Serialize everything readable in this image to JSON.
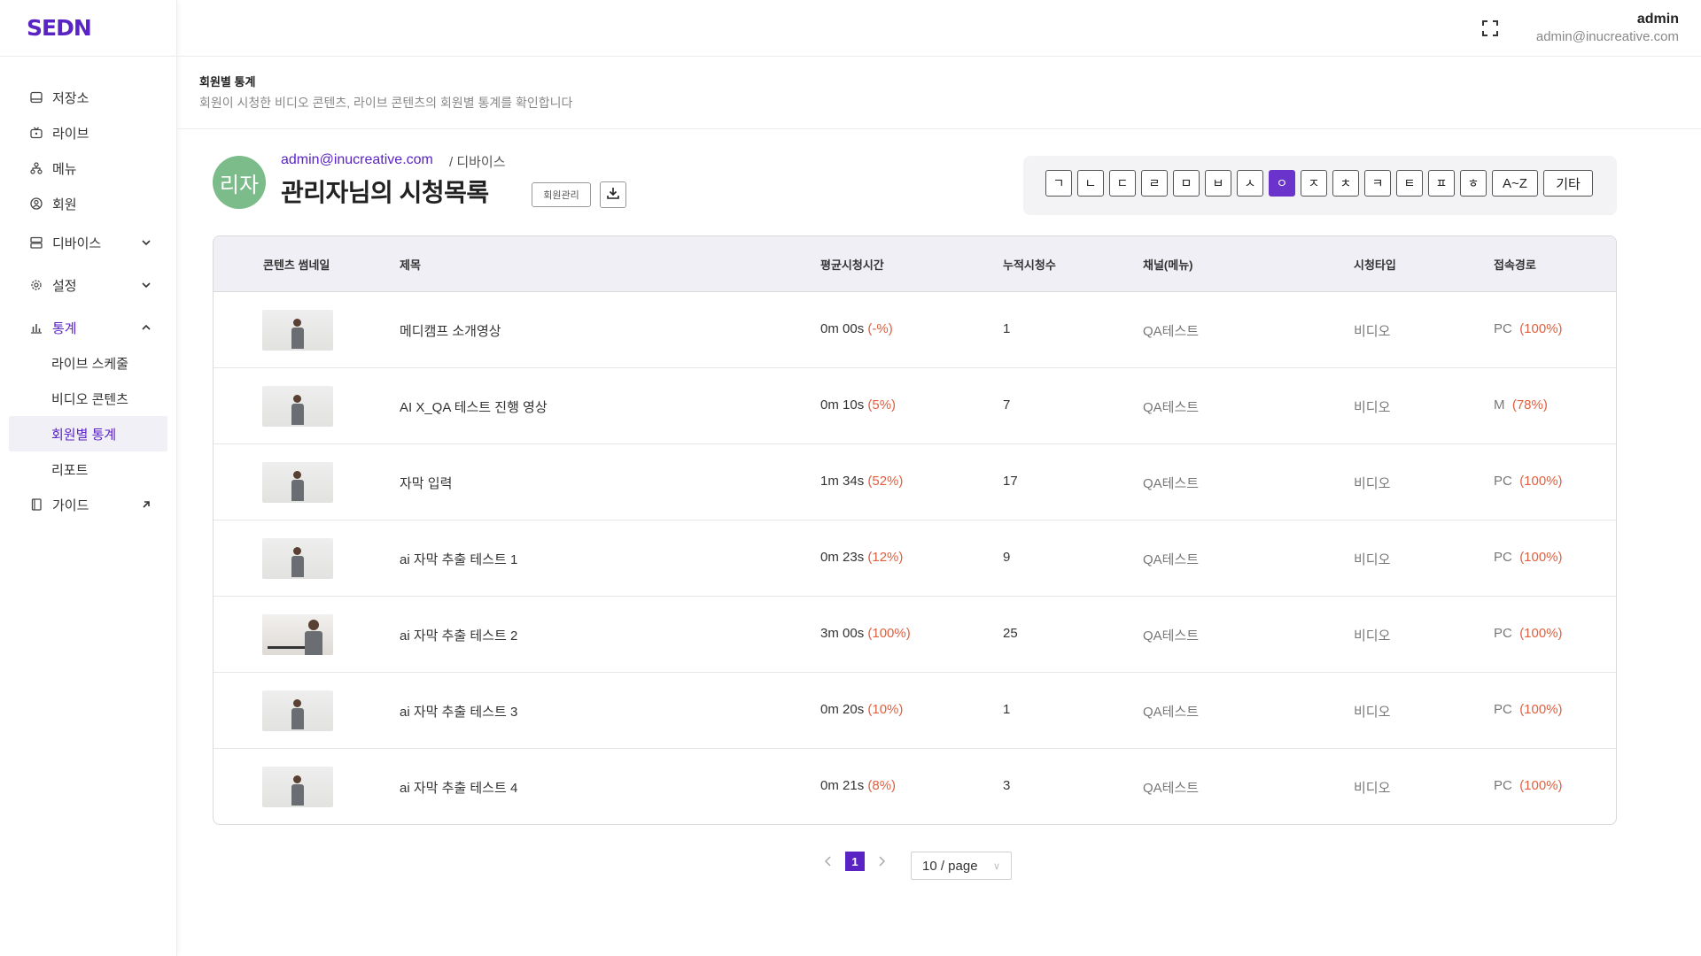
{
  "brand": {
    "logo": "SEDN",
    "accent": "#5a24c4"
  },
  "sidebar": {
    "items": [
      {
        "label": "저장소",
        "icon": "storage-icon"
      },
      {
        "label": "라이브",
        "icon": "live-tv-icon"
      },
      {
        "label": "메뉴",
        "icon": "menu-tree-icon"
      },
      {
        "label": "회원",
        "icon": "user-circle-icon"
      },
      {
        "label": "디바이스",
        "icon": "device-icon",
        "expandable": true,
        "expanded": false
      },
      {
        "label": "설정",
        "icon": "gear-icon",
        "expandable": true,
        "expanded": false
      },
      {
        "label": "통계",
        "icon": "bar-chart-icon",
        "expandable": true,
        "expanded": true
      }
    ],
    "stats_sub": [
      "라이브 스케줄",
      "비디오 콘텐츠",
      "회원별 통계",
      "리포트"
    ],
    "active_sub": "회원별 통계",
    "guide": {
      "label": "가이드",
      "icon": "book-icon"
    }
  },
  "topbar": {
    "user_name": "admin",
    "user_email": "admin@inucreative.com"
  },
  "page": {
    "title": "회원별 통계",
    "description": "회원이 시청한 비디오 콘텐츠, 라이브 콘텐츠의 회원별 통계를 확인합니다"
  },
  "profile": {
    "avatar_text": "리자",
    "avatar_color": "#7cbc8a",
    "email": "admin@inucreative.com",
    "breadcrumb": "/ 디바이스",
    "heading": "관리자님의 시청목록",
    "manage_button": "회원관리"
  },
  "filter": {
    "buttons": [
      "ㄱ",
      "ㄴ",
      "ㄷ",
      "ㄹ",
      "ㅁ",
      "ㅂ",
      "ㅅ",
      "ㅇ",
      "ㅈ",
      "ㅊ",
      "ㅋ",
      "ㅌ",
      "ㅍ",
      "ㅎ",
      "A~Z",
      "기타"
    ],
    "active": "ㅇ"
  },
  "table": {
    "headers": [
      "콘텐츠 썸네일",
      "제목",
      "평균시청시간",
      "누적시청수",
      "채널(메뉴)",
      "시청타입",
      "접속경로"
    ],
    "rows": [
      {
        "title": "메디캠프 소개영상",
        "avg_time": "0m 00s",
        "avg_pct": "(-%)",
        "views": "1",
        "channel": "QA테스트",
        "type": "비디오",
        "path": "PC",
        "path_pct": "(100%)"
      },
      {
        "title": "AI X_QA 테스트 진행 영상",
        "avg_time": "0m 10s",
        "avg_pct": "(5%)",
        "views": "7",
        "channel": "QA테스트",
        "type": "비디오",
        "path": "M",
        "path_pct": "(78%)"
      },
      {
        "title": "자막 입력",
        "avg_time": "1m 34s",
        "avg_pct": "(52%)",
        "views": "17",
        "channel": "QA테스트",
        "type": "비디오",
        "path": "PC",
        "path_pct": "(100%)"
      },
      {
        "title": "ai 자막 추출 테스트 1",
        "avg_time": "0m 23s",
        "avg_pct": "(12%)",
        "views": "9",
        "channel": "QA테스트",
        "type": "비디오",
        "path": "PC",
        "path_pct": "(100%)"
      },
      {
        "title": "ai 자막 추출 테스트 2",
        "avg_time": "3m 00s",
        "avg_pct": "(100%)",
        "views": "25",
        "channel": "QA테스트",
        "type": "비디오",
        "path": "PC",
        "path_pct": "(100%)"
      },
      {
        "title": "ai 자막 추출 테스트 3",
        "avg_time": "0m 20s",
        "avg_pct": "(10%)",
        "views": "1",
        "channel": "QA테스트",
        "type": "비디오",
        "path": "PC",
        "path_pct": "(100%)"
      },
      {
        "title": "ai 자막 추출 테스트 4",
        "avg_time": "0m 21s",
        "avg_pct": "(8%)",
        "views": "3",
        "channel": "QA테스트",
        "type": "비디오",
        "path": "PC",
        "path_pct": "(100%)"
      }
    ]
  },
  "pagination": {
    "current": "1",
    "page_size": "10 / page"
  }
}
